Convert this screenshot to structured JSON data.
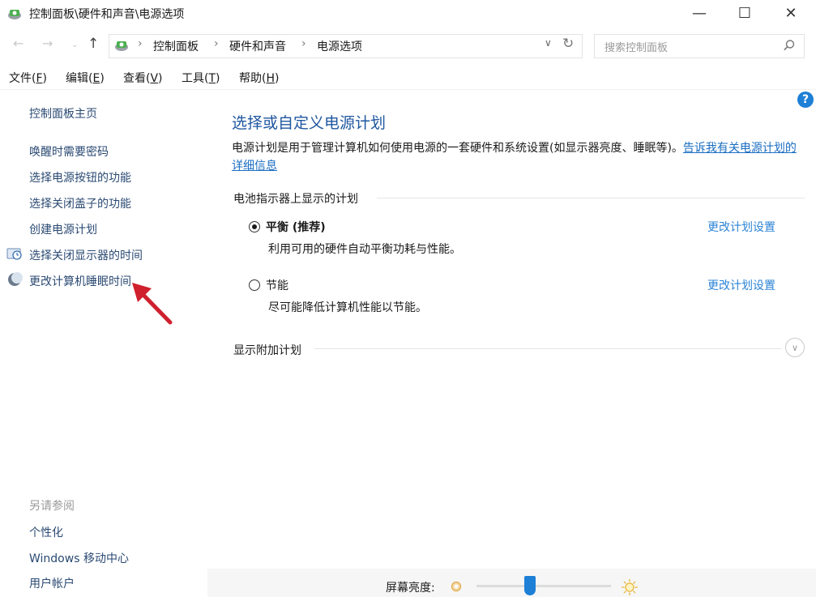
{
  "window": {
    "title": "控制面板\\硬件和声音\\电源选项",
    "minimize": "—",
    "maximize": "☐",
    "close": "✕"
  },
  "address": {
    "breadcrumbs": [
      "控制面板",
      "硬件和声音",
      "电源选项"
    ],
    "separator": "›",
    "search_placeholder": "搜索控制面板"
  },
  "menu": {
    "items": [
      {
        "label": "文件",
        "key": "F"
      },
      {
        "label": "编辑",
        "key": "E"
      },
      {
        "label": "查看",
        "key": "V"
      },
      {
        "label": "工具",
        "key": "T"
      },
      {
        "label": "帮助",
        "key": "H"
      }
    ]
  },
  "sidebar": {
    "home": "控制面板主页",
    "items": [
      "唤醒时需要密码",
      "选择电源按钮的功能",
      "选择关闭盖子的功能",
      "创建电源计划",
      "选择关闭显示器的时间",
      "更改计算机睡眠时间"
    ],
    "see_also_label": "另请参阅",
    "see_also": [
      "个性化",
      "Windows 移动中心",
      "用户帐户"
    ]
  },
  "main": {
    "title": "选择或自定义电源计划",
    "description": "电源计划是用于管理计算机如何使用电源的一套硬件和系统设置(如显示器亮度、睡眠等)。",
    "description_link": "告诉我有关电源计划的详细信息",
    "section_label": "电池指示器上显示的计划",
    "plans": [
      {
        "name": "平衡 (推荐)",
        "description": "利用可用的硬件自动平衡功耗与性能。",
        "selected": true,
        "change_link": "更改计划设置"
      },
      {
        "name": "节能",
        "description": "尽可能降低计算机性能以节能。",
        "selected": false,
        "change_link": "更改计划设置"
      }
    ],
    "show_more": "显示附加计划",
    "help": "?"
  },
  "bottom": {
    "brightness_label": "屏幕亮度:",
    "brightness_level": 0.4
  },
  "colors": {
    "title_blue": "#1f57a0",
    "link_blue": "#2b83d6",
    "slider_blue": "#1d7fd6",
    "arrow_red": "#d0202e"
  }
}
